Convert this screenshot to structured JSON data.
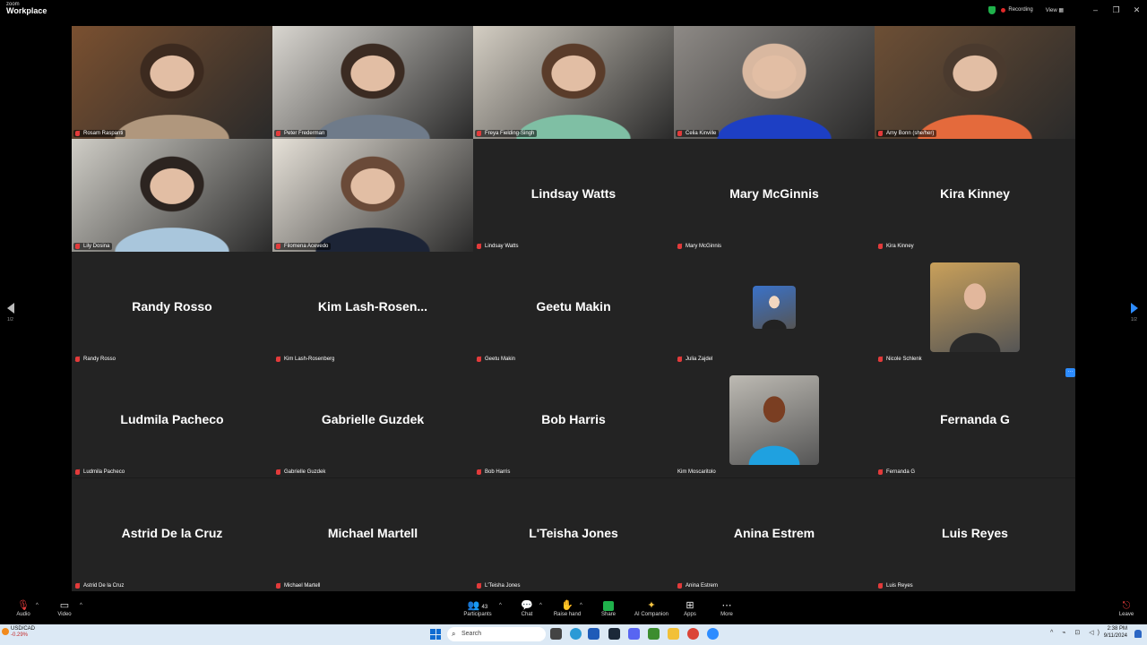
{
  "app": {
    "brand_small": "zoom",
    "brand_big": "Workplace"
  },
  "titlebar": {
    "recording": "Recording",
    "view": "View",
    "view_icon": "grid-icon",
    "minimize": "–",
    "restore": "❐",
    "close": "✕"
  },
  "pagination": {
    "left": "1/2",
    "right": "1/2"
  },
  "grid_more_button": "···",
  "tiles": [
    {
      "name": "Rosam Raspanti",
      "label": "Rosam Raspanti",
      "type": "video",
      "palette": [
        "#7a5030",
        "#b0977d",
        "#3c2a1f"
      ]
    },
    {
      "name": "Peter Frederman",
      "label": "Peter Frederman",
      "type": "video",
      "palette": [
        "#d9d6d0",
        "#6f7b8a",
        "#3b2b22"
      ]
    },
    {
      "name": "Freya Fielding-Singh",
      "label": "Freya Fielding-Singh",
      "type": "video",
      "speaking": true,
      "palette": [
        "#d4cec3",
        "#7fbfa4",
        "#5a3c2a"
      ]
    },
    {
      "name": "Celia Kinville",
      "label": "Celia Kinville",
      "type": "video",
      "palette": [
        "#8e8a86",
        "#1d3fc4",
        "#d9b8a0"
      ]
    },
    {
      "name": "Amy Bonn (she/her)",
      "label": "Amy Bonn (she/her)",
      "type": "video",
      "palette": [
        "#6d4f35",
        "#e46a3c",
        "#4a3a2e"
      ]
    },
    {
      "name": "Lily Dosina",
      "label": "Lily Dosina",
      "type": "video",
      "palette": [
        "#cfcdc6",
        "#a9c6dc",
        "#2c2420"
      ]
    },
    {
      "name": "Filomena Acevedo",
      "label": "Filomena Acevedo",
      "type": "video",
      "palette": [
        "#e6e1d8",
        "#1c2436",
        "#6a4a38"
      ]
    },
    {
      "name": "Lindsay Watts",
      "label": "Lindsay Watts",
      "type": "name"
    },
    {
      "name": "Mary McGinnis",
      "label": "Mary McGinnis",
      "type": "name"
    },
    {
      "name": "Kira Kinney",
      "label": "Kira Kinney",
      "type": "name"
    },
    {
      "name": "Randy Rosso",
      "label": "Randy Rosso",
      "type": "name"
    },
    {
      "name": "Kim  Lash-Rosen...",
      "label": "Kim Lash-Rosenberg",
      "type": "name"
    },
    {
      "name": "Geetu Makin",
      "label": "Geetu Makin",
      "type": "name"
    },
    {
      "name": "Julia Zajdel",
      "label": "Julia Zajdel",
      "type": "avatar",
      "avatar_kind": "cartoon-avatar",
      "palette": [
        "#3a72c9",
        "#222",
        "#f2d7c0"
      ]
    },
    {
      "name": "Nicole Schlenk",
      "label": "Nicole Schlenk",
      "type": "avatar",
      "avatar_kind": "photo-avatar",
      "palette": [
        "#c9a05a",
        "#2a2a2a",
        "#e2b79c"
      ]
    },
    {
      "name": "Ludmila Pacheco",
      "label": "Ludmila Pacheco",
      "type": "name"
    },
    {
      "name": "Gabrielle Guzdek",
      "label": "Gabrielle Guzdek",
      "type": "name"
    },
    {
      "name": "Bob Harris",
      "label": "Bob Harris",
      "type": "name"
    },
    {
      "name": "Kim Moscaritolo",
      "label": "Kim Moscaritolo",
      "type": "avatar",
      "avatar_kind": "photo-avatar",
      "no_mic": true,
      "palette": [
        "#bdbab3",
        "#1fa1e0",
        "#7a3e22"
      ]
    },
    {
      "name": "Fernanda G",
      "label": "Fernanda G",
      "type": "name"
    },
    {
      "name": "Astrid De la Cruz",
      "label": "Astrid De la Cruz",
      "type": "name"
    },
    {
      "name": "Michael Martell",
      "label": "Michael Martell",
      "type": "name"
    },
    {
      "name": "L'Teisha Jones",
      "label": "L'Teisha Jones",
      "type": "name"
    },
    {
      "name": "Anina Estrem",
      "label": "Anina Estrem",
      "type": "name"
    },
    {
      "name": "Luis Reyes",
      "label": "Luis Reyes",
      "type": "name"
    }
  ],
  "toolbar": {
    "audio": "Audio",
    "video": "Video",
    "participants": "Participants",
    "participants_count": "43",
    "chat": "Chat",
    "raise_hand": "Raise hand",
    "share": "Share",
    "ai_companion": "AI Companion",
    "apps": "Apps",
    "more": "More",
    "leave": "Leave",
    "caret": "^"
  },
  "taskbar": {
    "ticker_name": "USD/CAD",
    "ticker_value": "-0.29%",
    "search_placeholder": "Search",
    "time": "2:38 PM",
    "date": "9/11/2024",
    "tray": "^ ⌁ ⊡ ◁)"
  },
  "colors": {
    "accent": "#2d8cff",
    "speaking": "#23d959",
    "recording": "#e02828",
    "mic_muted": "#e33b3b"
  }
}
